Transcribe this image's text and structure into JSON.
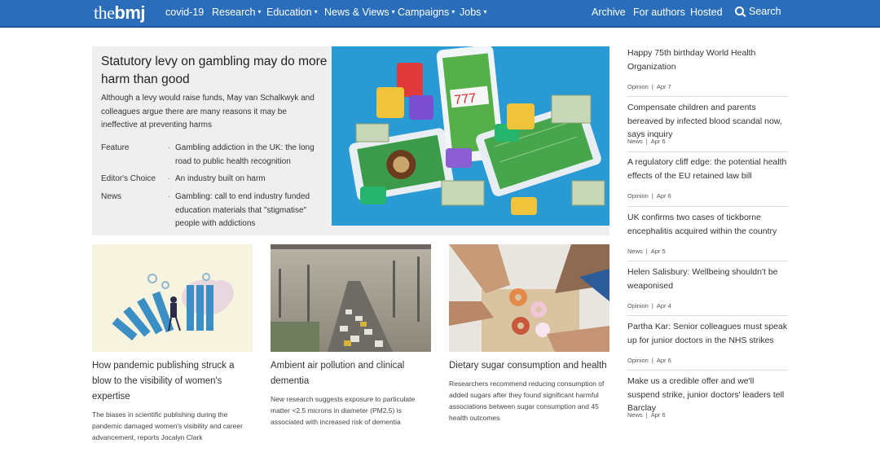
{
  "nav": {
    "logo_pre": "the",
    "logo_bold": "bmj",
    "items": [
      {
        "label": "covid-19",
        "dropdown": false
      },
      {
        "label": "Research",
        "dropdown": true
      },
      {
        "label": "Education",
        "dropdown": true
      },
      {
        "label": "News & Views",
        "dropdown": true
      },
      {
        "label": "Campaigns",
        "dropdown": true
      },
      {
        "label": "Jobs",
        "dropdown": true
      }
    ],
    "right": [
      {
        "label": "Archive"
      },
      {
        "label": "For authors"
      },
      {
        "label": "Hosted"
      }
    ],
    "search_label": "Search",
    "color": "#2a6ebb"
  },
  "feature": {
    "title": "Statutory levy on gambling may do more harm than good",
    "standfirst": "Although a levy would raise funds, May van Schalkwyk and colleagues argue there are many reasons it may be ineffective at preventing harms",
    "related": [
      {
        "type": "Feature",
        "text": "Gambling addiction in the UK: the long road to public health recognition"
      },
      {
        "type": "Editor's Choice",
        "text": "An industry built on harm"
      },
      {
        "type": "News",
        "text": "Gambling: call to end industry funded education materials that \"stigmatise\" people with addictions"
      }
    ],
    "separator": "·"
  },
  "cards": [
    {
      "title": "How pandemic publishing struck a blow to the visibility of women's expertise",
      "desc": "The biases in scientific publishing during the pandemic damaged women's visibility and career advancement, reports Jocalyn Clark"
    },
    {
      "title": "Ambient air pollution and clinical dementia",
      "desc": "New research suggests exposure to particulate matter <2.5 microns in diameter (PM2.5) is associated with increased risk of dementia"
    },
    {
      "title": "Dietary sugar consumption and health",
      "desc": "Researchers recommend reducing consumption of added sugars after they found significant harmful associations between sugar consumption and 45 health outcomes"
    }
  ],
  "sidebar": [
    {
      "title": "Happy 75th birthday World Health Organization",
      "type": "Opinion",
      "date": "Apr 7"
    },
    {
      "title": "Compensate children and parents bereaved by infected blood scandal now, says inquiry",
      "type": "News",
      "date": "Apr 6"
    },
    {
      "title": "A regulatory cliff edge: the potential health effects of the EU retained law bill",
      "type": "Opinion",
      "date": "Apr 6"
    },
    {
      "title": "UK confirms two cases of tickborne encephalitis acquired within the country",
      "type": "News",
      "date": "Apr 5"
    },
    {
      "title": "Helen Salisbury: Wellbeing shouldn't be weaponised",
      "type": "Opinion",
      "date": "Apr 4"
    },
    {
      "title": "Partha Kar: Senior colleagues must speak up for junior doctors in the NHS strikes",
      "type": "Opinion",
      "date": "Apr 6"
    },
    {
      "title": "Make us a credible offer and we'll suspend strike, junior doctors' leaders tell Barclay",
      "type": "News",
      "date": "Apr 6"
    }
  ],
  "meta_separator": "|"
}
